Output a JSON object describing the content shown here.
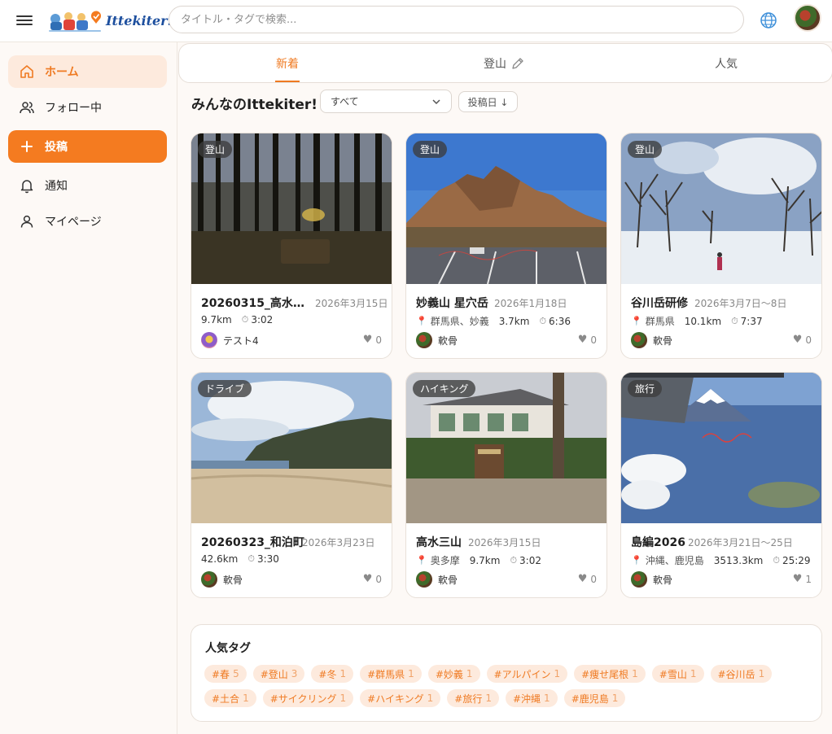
{
  "header": {
    "logo_text": "Ittekiter!",
    "search_placeholder": "タイトル・タグで検索..."
  },
  "sidebar": {
    "items": [
      {
        "label": "ホーム",
        "icon": "home-icon"
      },
      {
        "label": "フォロー中",
        "icon": "users-icon"
      },
      {
        "label": "投稿",
        "icon": "plus-icon"
      },
      {
        "label": "通知",
        "icon": "bell-icon"
      },
      {
        "label": "マイページ",
        "icon": "user-icon"
      }
    ]
  },
  "tabs": [
    {
      "label": "新着",
      "active": true
    },
    {
      "label": "登山",
      "icon": "pencil-icon"
    },
    {
      "label": "人気"
    }
  ],
  "main": {
    "title": "みんなのIttekiter!",
    "filter_value": "すべて",
    "sort_label": "投稿日 ↓"
  },
  "cards": [
    {
      "badge": "登山",
      "title": "20260315_高水三…",
      "date": "2026年3月15日",
      "place": "",
      "distance": "9.7km",
      "time": "3:02",
      "user": "テスト4",
      "likes": "0"
    },
    {
      "badge": "登山",
      "title": "妙義山 星穴岳",
      "date": "2026年1月18日",
      "place": "群馬県、妙義",
      "distance": "3.7km",
      "time": "6:36",
      "user": "軟骨",
      "likes": "0"
    },
    {
      "badge": "登山",
      "title": "谷川岳研修",
      "date": "2026年3月7日〜8日",
      "place": "群馬県",
      "distance": "10.1km",
      "time": "7:37",
      "user": "軟骨",
      "likes": "0"
    },
    {
      "badge": "ドライブ",
      "title": "20260323_和泊町",
      "date": "2026年3月23日",
      "place": "",
      "distance": "42.6km",
      "time": "3:30",
      "user": "軟骨",
      "likes": "0"
    },
    {
      "badge": "ハイキング",
      "title": "高水三山",
      "date": "2026年3月15日",
      "place": "奥多摩",
      "distance": "9.7km",
      "time": "3:02",
      "user": "軟骨",
      "likes": "0"
    },
    {
      "badge": "旅行",
      "title": "島編2026",
      "date": "2026年3月21日〜25日",
      "place": "沖縄、鹿児島",
      "distance": "3513.3km",
      "time": "25:29",
      "user": "軟骨",
      "likes": "1"
    }
  ],
  "tags": {
    "title": "人気タグ",
    "items": [
      {
        "name": "#春",
        "count": "5"
      },
      {
        "name": "#登山",
        "count": "3"
      },
      {
        "name": "#冬",
        "count": "1"
      },
      {
        "name": "#群馬県",
        "count": "1"
      },
      {
        "name": "#妙義",
        "count": "1"
      },
      {
        "name": "#アルパイン",
        "count": "1"
      },
      {
        "name": "#痩せ尾根",
        "count": "1"
      },
      {
        "name": "#雪山",
        "count": "1"
      },
      {
        "name": "#谷川岳",
        "count": "1"
      },
      {
        "name": "#土合",
        "count": "1"
      },
      {
        "name": "#サイクリング",
        "count": "1"
      },
      {
        "name": "#ハイキング",
        "count": "1"
      },
      {
        "name": "#旅行",
        "count": "1"
      },
      {
        "name": "#沖縄",
        "count": "1"
      },
      {
        "name": "#鹿児島",
        "count": "1"
      }
    ]
  },
  "colors": {
    "accent": "#f47b20",
    "accent_light": "#fdeadd",
    "background": "#fdf9f6"
  }
}
